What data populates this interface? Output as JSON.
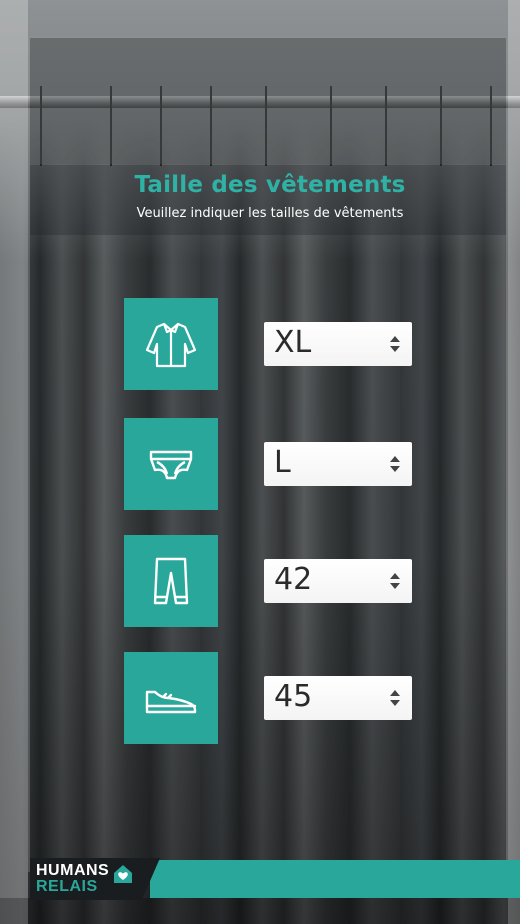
{
  "header": {
    "title": "Taille des vêtements",
    "subtitle": "Veuillez indiquer les tailles de vêtements"
  },
  "sizes": [
    {
      "icon": "shirt-icon",
      "value": "XL"
    },
    {
      "icon": "underwear-icon",
      "value": "L"
    },
    {
      "icon": "pants-icon",
      "value": "42"
    },
    {
      "icon": "shoe-icon",
      "value": "45"
    }
  ],
  "footer": {
    "logo_line1": "HUMANS",
    "logo_line2": "RELAIS",
    "logo_icon": "heart-house-icon"
  },
  "colors": {
    "accent": "#2aa79b",
    "title": "#2fb2a6",
    "select_bg": "#ffffff"
  }
}
